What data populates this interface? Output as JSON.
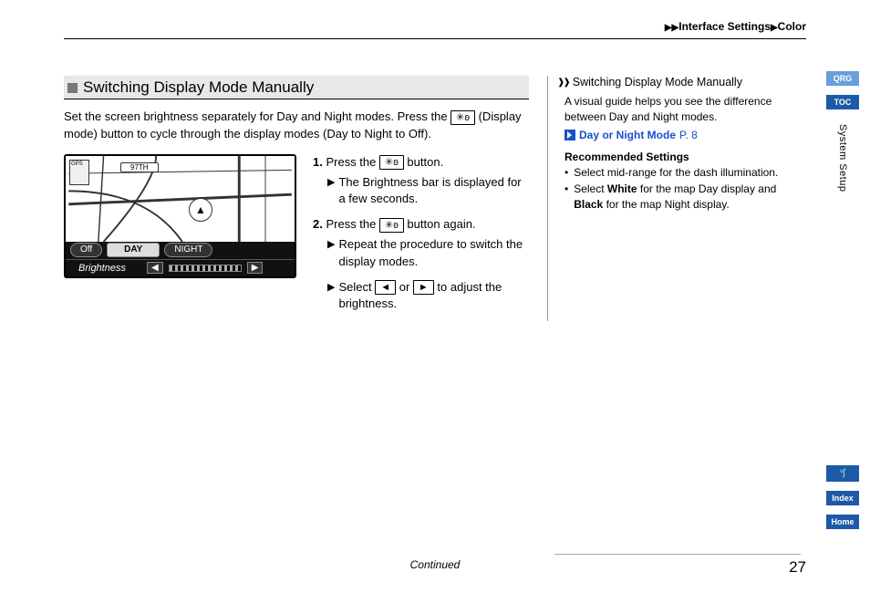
{
  "breadcrumb": {
    "a": "Interface Settings",
    "b": "Color"
  },
  "section_title": "Switching Display Mode Manually",
  "intro_a": "Set the screen brightness separately for Day and Night modes. Press the ",
  "intro_btn": "✳ʚ",
  "intro_b": " (Display mode) button to cycle through the display modes (Day to Night to Off).",
  "device": {
    "gps": "GPS",
    "road": "97TH",
    "off": "Off",
    "day": "DAY",
    "night": "NIGHT",
    "brightness": "Brightness"
  },
  "steps": {
    "s1_num": "1.",
    "s1_a": "Press the ",
    "s1_b": " button.",
    "s1_sub": "The Brightness bar is displayed for a few seconds.",
    "s2_num": "2.",
    "s2_a": "Press the ",
    "s2_b": " button again.",
    "s2_sub1": "Repeat the procedure to switch the display modes.",
    "s2_sub2_a": "Select ",
    "s2_sub2_b": " or ",
    "s2_sub2_c": " to adjust the brightness.",
    "left_arrow": "◄",
    "right_arrow": "►"
  },
  "side": {
    "title": "Switching Display Mode Manually",
    "body": "A visual guide helps you see the difference between Day and Night modes.",
    "link_label": "Day or Night Mode",
    "link_page": "P. 8",
    "rec_title": "Recommended Settings",
    "b1": "Select mid-range for the dash illumination.",
    "b2_a": "Select ",
    "b2_white": "White",
    "b2_b": " for the map Day display and ",
    "b2_black": "Black",
    "b2_c": " for the map Night display."
  },
  "rail": {
    "qrg": "QRG",
    "toc": "TOC",
    "section": "System Setup",
    "voice": "ᵛʃ",
    "index": "Index",
    "home": "Home"
  },
  "footer": {
    "continued": "Continued",
    "page": "27"
  }
}
